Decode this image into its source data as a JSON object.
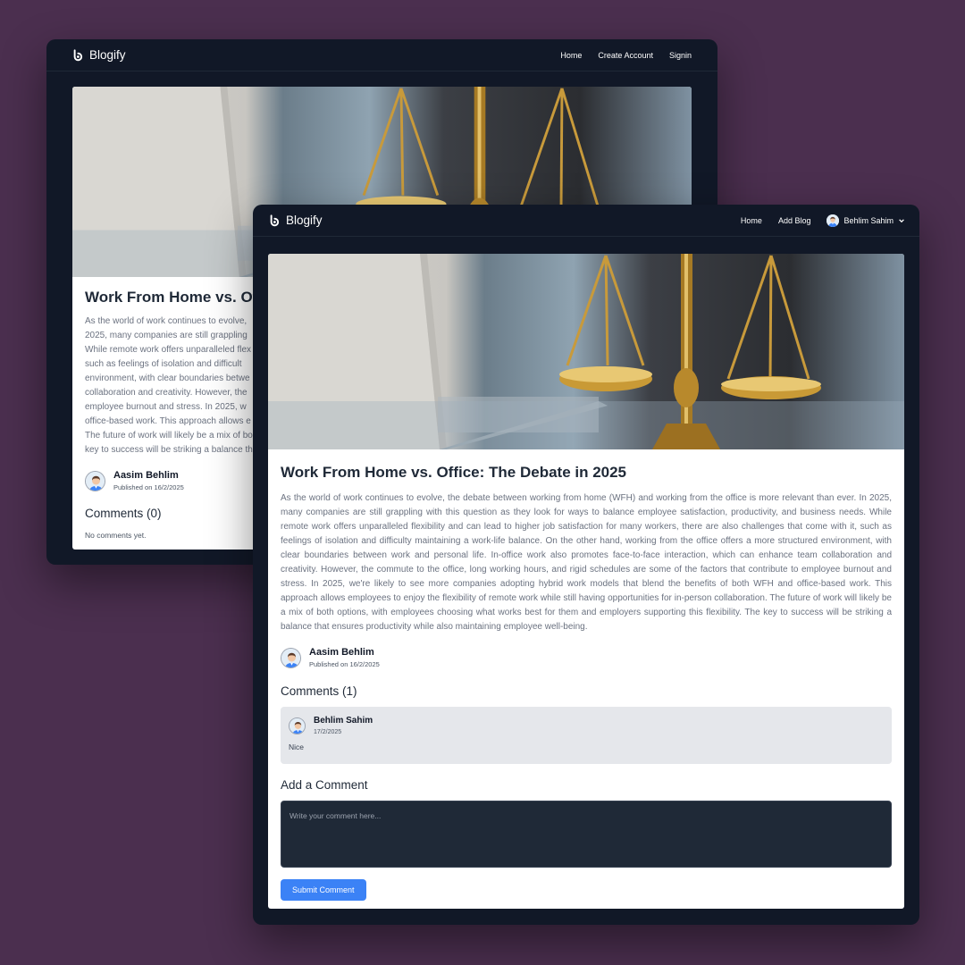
{
  "brand": "Blogify",
  "colors": {
    "background": "#4b2f4f",
    "nav": "#111827",
    "accent": "#3b82f6",
    "comment_bg": "#e5e7eb"
  },
  "back_window": {
    "nav": {
      "home": "Home",
      "create_account": "Create Account",
      "signin": "Signin"
    },
    "post": {
      "title": "Work From Home vs. Of",
      "lines": [
        "As the world of work continues to evolve,",
        "2025, many companies are still grappling",
        "While remote work offers unparalleled flex",
        "such as feelings of isolation and difficult",
        "environment, with clear boundaries betwe",
        "collaboration and creativity. However, the",
        "employee burnout and stress. In 2025, w",
        "office-based work. This approach allows e",
        "The future of work will likely be a mix of bo",
        "key to success will be striking a balance th"
      ],
      "author": "Aasim Behlim",
      "published": "Published on 16/2/2025"
    },
    "comments_heading": "Comments (0)",
    "no_comments": "No comments yet."
  },
  "front_window": {
    "nav": {
      "home": "Home",
      "add_blog": "Add Blog",
      "user": "Behlim Sahim",
      "user_icon": "user-avatar-icon",
      "dropdown_icon": "chevron-down-icon"
    },
    "post": {
      "title": "Work From Home vs. Office: The Debate in 2025",
      "body": "As the world of work continues to evolve, the debate between working from home (WFH) and working from the office is more relevant than ever. In 2025, many companies are still grappling with this question as they look for ways to balance employee satisfaction, productivity, and business needs. While remote work offers unparalleled flexibility and can lead to higher job satisfaction for many workers, there are also challenges that come with it, such as feelings of isolation and difficulty maintaining a work-life balance. On the other hand, working from the office offers a more structured environment, with clear boundaries between work and personal life. In-office work also promotes face-to-face interaction, which can enhance team collaboration and creativity. However, the commute to the office, long working hours, and rigid schedules are some of the factors that contribute to employee burnout and stress. In 2025, we're likely to see more companies adopting hybrid work models that blend the benefits of both WFH and office-based work. This approach allows employees to enjoy the flexibility of remote work while still having opportunities for in-person collaboration. The future of work will likely be a mix of both options, with employees choosing what works best for them and employers supporting this flexibility. The key to success will be striking a balance that ensures productivity while also maintaining employee well-being.",
      "author": "Aasim Behlim",
      "published": "Published on 16/2/2025"
    },
    "comments_heading": "Comments (1)",
    "comments": [
      {
        "author": "Behlim Sahim",
        "date": "17/2/2025",
        "text": "Nice"
      }
    ],
    "add_comment_heading": "Add a Comment",
    "comment_placeholder": "Write your comment here...",
    "submit_label": "Submit Comment"
  }
}
